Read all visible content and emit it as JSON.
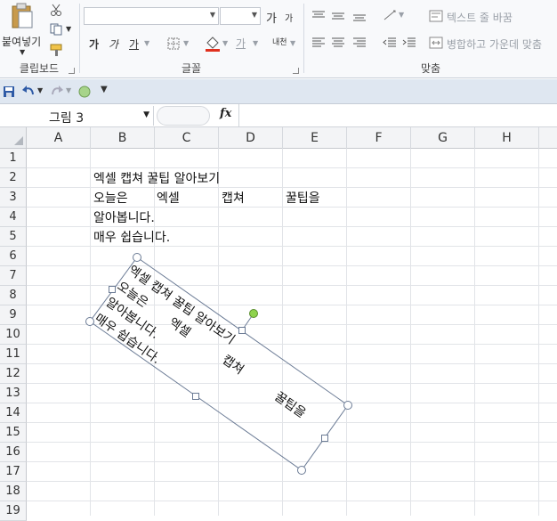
{
  "ribbon": {
    "clipboard": {
      "paste_label": "붙여넣기",
      "group_label": "클립보드"
    },
    "font": {
      "font_name": "",
      "font_size": "",
      "bold": "가",
      "italic": "가",
      "underline": "가",
      "grow": "가",
      "shrink": "가",
      "phonetic": "내천",
      "font_color": "가",
      "group_label": "글꼴"
    },
    "alignment": {
      "wrap_text": "텍스트 줄 바꿈",
      "merge_center": "병합하고 가운데 맞춤",
      "group_label": "맞춤"
    }
  },
  "formula_bar": {
    "name_box": "그림 3",
    "fx": "fx",
    "formula": ""
  },
  "columns": [
    "A",
    "B",
    "C",
    "D",
    "E",
    "F",
    "G",
    "H"
  ],
  "rows": [
    "1",
    "2",
    "3",
    "4",
    "5",
    "6",
    "7",
    "8",
    "9",
    "10",
    "11",
    "12",
    "13",
    "14",
    "15",
    "16",
    "17",
    "18",
    "19"
  ],
  "cells": {
    "b2": "엑셀 캡쳐 꿀팁 알아보기",
    "b3_words": [
      "오늘은",
      "엑셀",
      "캡쳐",
      "꿀팁을"
    ],
    "b4": "알아봅니다.",
    "b5": "매우 쉽습니다."
  },
  "picture": {
    "line1": "엑셀 캡쳐 꿀팁 알아보기",
    "line2a": "오늘은",
    "line2b": "엑셀",
    "line2c": "캡쳐",
    "line2d": "꿀팁을",
    "line3": "알아봅니다.",
    "line4": "매우 쉽습니다."
  }
}
